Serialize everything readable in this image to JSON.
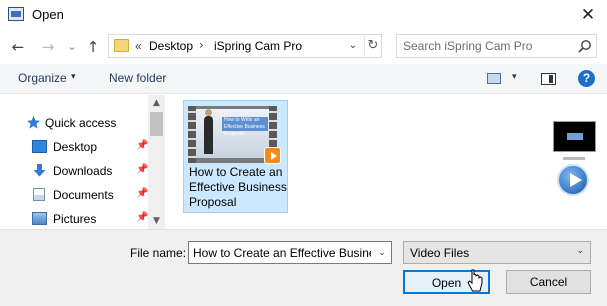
{
  "window": {
    "title": "Open",
    "close_glyph": "✕"
  },
  "nav": {
    "back": "←",
    "forward": "→",
    "recent": "⌄",
    "up": "↑"
  },
  "address": {
    "chevron": "«",
    "segments": [
      "Desktop",
      "iSpring Cam Pro"
    ],
    "separator": "›",
    "dropdown": "⌄",
    "refresh": "↻"
  },
  "search": {
    "placeholder": "Search iSpring Cam Pro",
    "icon": "search-icon"
  },
  "toolbar": {
    "organize_label": "Organize",
    "organize_arrow": "▾",
    "new_folder_label": "New folder",
    "view_arrow": "▾",
    "help": "?"
  },
  "sidebar": {
    "items": [
      {
        "label": "Quick access",
        "icon": "star-icon",
        "pinned": false
      },
      {
        "label": "Desktop",
        "icon": "desktop-icon",
        "pinned": true
      },
      {
        "label": "Downloads",
        "icon": "download-icon",
        "pinned": true
      },
      {
        "label": "Documents",
        "icon": "documents-icon",
        "pinned": true
      },
      {
        "label": "Pictures",
        "icon": "pictures-icon",
        "pinned": true
      }
    ],
    "pin_glyph": "📌",
    "scroll_up": "▲",
    "scroll_down": "▼"
  },
  "files": [
    {
      "name": "How to Create an Effective Business Proposal",
      "thumbnail_text": "How to Write an Effective Business Proposal",
      "selected": true
    }
  ],
  "footer": {
    "filename_label": "File name:",
    "filename_value": "How to Create an Effective Busine",
    "filename_dropdown": "⌄",
    "filetype_value": "Video Files",
    "filetype_arrow": "⌄",
    "open_label": "Open",
    "cancel_label": "Cancel"
  },
  "colors": {
    "accent": "#0078d7",
    "selection": "#cce8ff",
    "help": "#1b6fc9"
  }
}
